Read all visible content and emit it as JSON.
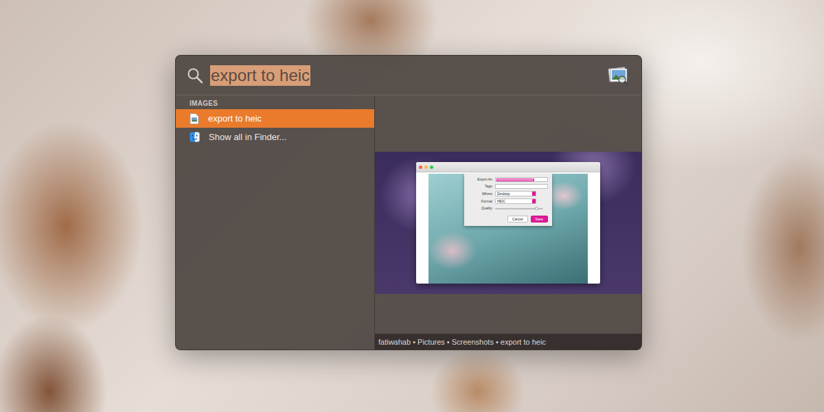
{
  "search": {
    "query": "export to heic"
  },
  "sections": [
    {
      "title": "IMAGES",
      "items": [
        {
          "label": "export to heic",
          "kind": "file",
          "selected": true
        },
        {
          "label": "Show all in Finder...",
          "kind": "finder",
          "selected": false
        }
      ]
    }
  ],
  "preview": {
    "path": "fatiwahab • Pictures • Screenshots • export to heic",
    "dialog": {
      "rows": [
        {
          "label": "Export As:",
          "kind": "name"
        },
        {
          "label": "Tags:",
          "kind": "tags"
        },
        {
          "label": "Where:",
          "kind": "select",
          "value": "Desktop"
        },
        {
          "label": "Format:",
          "kind": "select",
          "value": "HEIC"
        },
        {
          "label": "Quality:",
          "kind": "slider",
          "level": 0.85
        }
      ],
      "buttons": [
        {
          "label": "Cancel",
          "default": false
        },
        {
          "label": "Save",
          "default": true
        }
      ]
    }
  }
}
